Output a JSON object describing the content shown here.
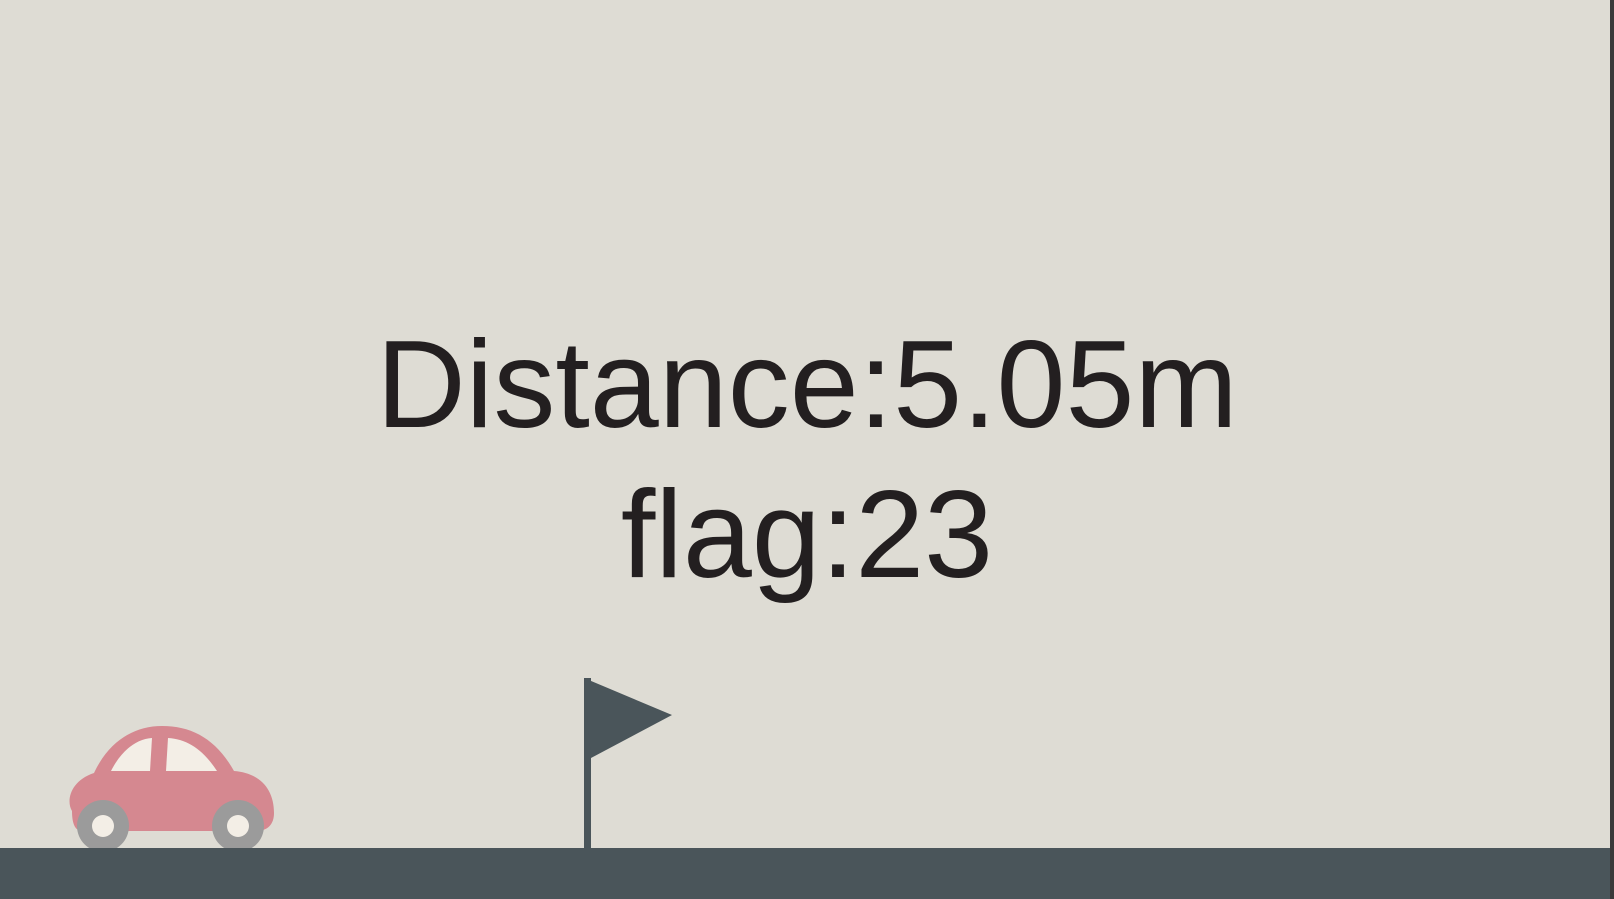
{
  "hud": {
    "distance_text": "Distance:5.05m",
    "flag_text": "flag:23"
  },
  "sprites": {
    "player": "car-icon",
    "checkpoint": "flag-icon"
  },
  "colors": {
    "background": "#dedcd4",
    "ground": "#4a555a",
    "text": "#231f20",
    "car_body": "#d58890",
    "car_window": "#f3eee6",
    "wheel": "#9b9b9b",
    "flag": "#4a555a",
    "edge_strip": "#3a3a3a"
  }
}
